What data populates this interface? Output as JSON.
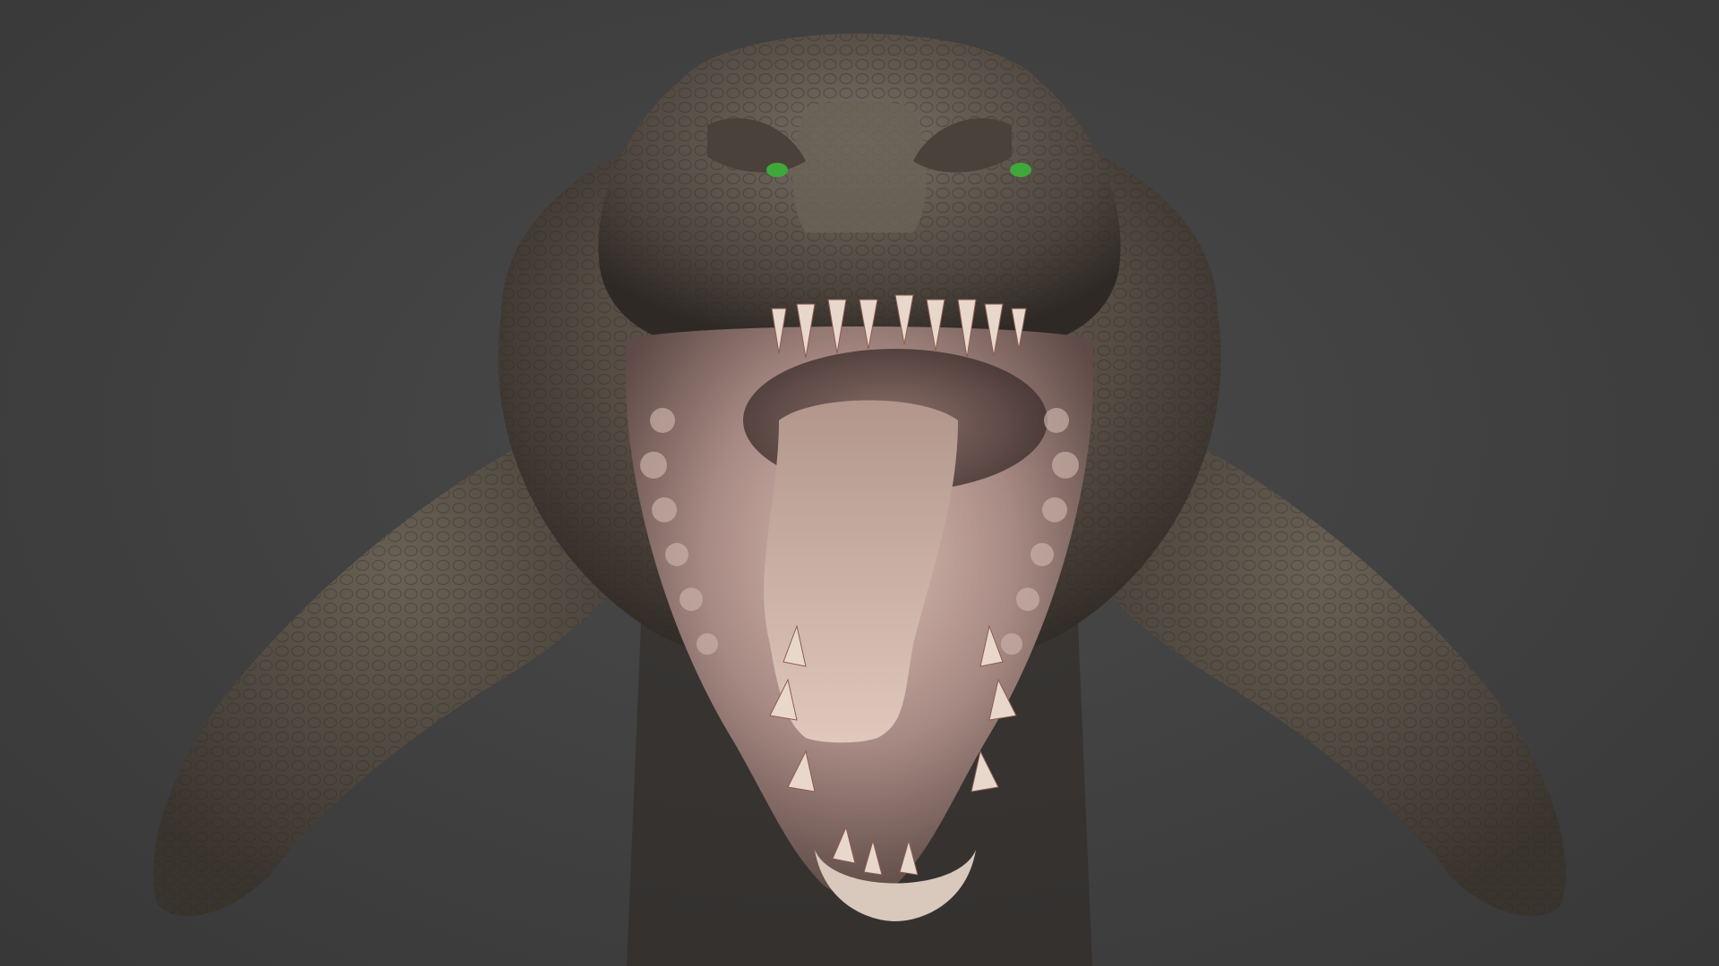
{
  "scene": {
    "subject": "dinosaur-sculpt-front-view",
    "colors": {
      "background": "#404040",
      "skin": "#5a5248",
      "skin_dark": "#3a342e",
      "skin_light": "#7a6e62",
      "mouth_inner": "#b89a94",
      "tongue": "#c8aca0",
      "teeth": "#e8d8cc",
      "eye": "#3fa83a"
    }
  }
}
